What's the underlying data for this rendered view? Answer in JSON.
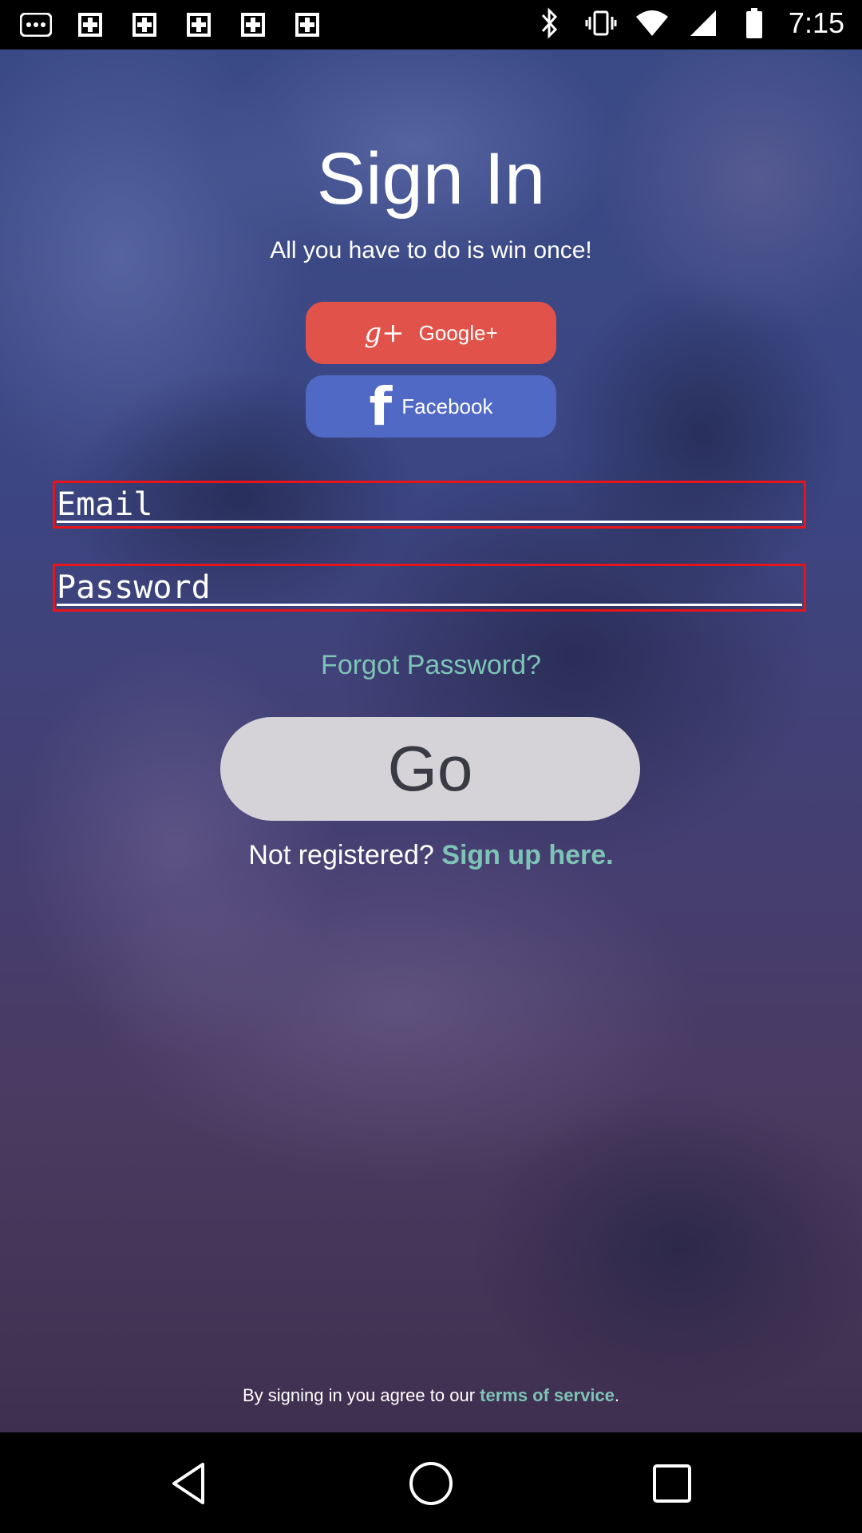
{
  "status_bar": {
    "time": "7:15",
    "left_icons": [
      "more-icon",
      "photo-icon",
      "photo-icon",
      "photo-icon",
      "photo-icon",
      "photo-icon"
    ],
    "right_icons": [
      "bluetooth-icon",
      "vibrate-icon",
      "wifi-icon",
      "signal-icon",
      "battery-icon"
    ]
  },
  "header": {
    "title": "Sign In",
    "subtitle": "All you have to do is win once!"
  },
  "social": {
    "google_label": "Google+",
    "google_glyph": "g+",
    "facebook_label": "Facebook",
    "facebook_glyph": "f",
    "google_color": "#e1524a",
    "facebook_color": "#4f69c4"
  },
  "form": {
    "email_placeholder": "Email",
    "password_placeholder": "Password",
    "forgot_label": "Forgot Password?",
    "go_label": "Go"
  },
  "register": {
    "prefix": "Not registered? ",
    "link": "Sign up here."
  },
  "terms": {
    "prefix": "By signing in you agree to our ",
    "link": "terms of service",
    "suffix": "."
  },
  "colors": {
    "accent": "#7ec4b6",
    "field_border": "#e8141b"
  }
}
